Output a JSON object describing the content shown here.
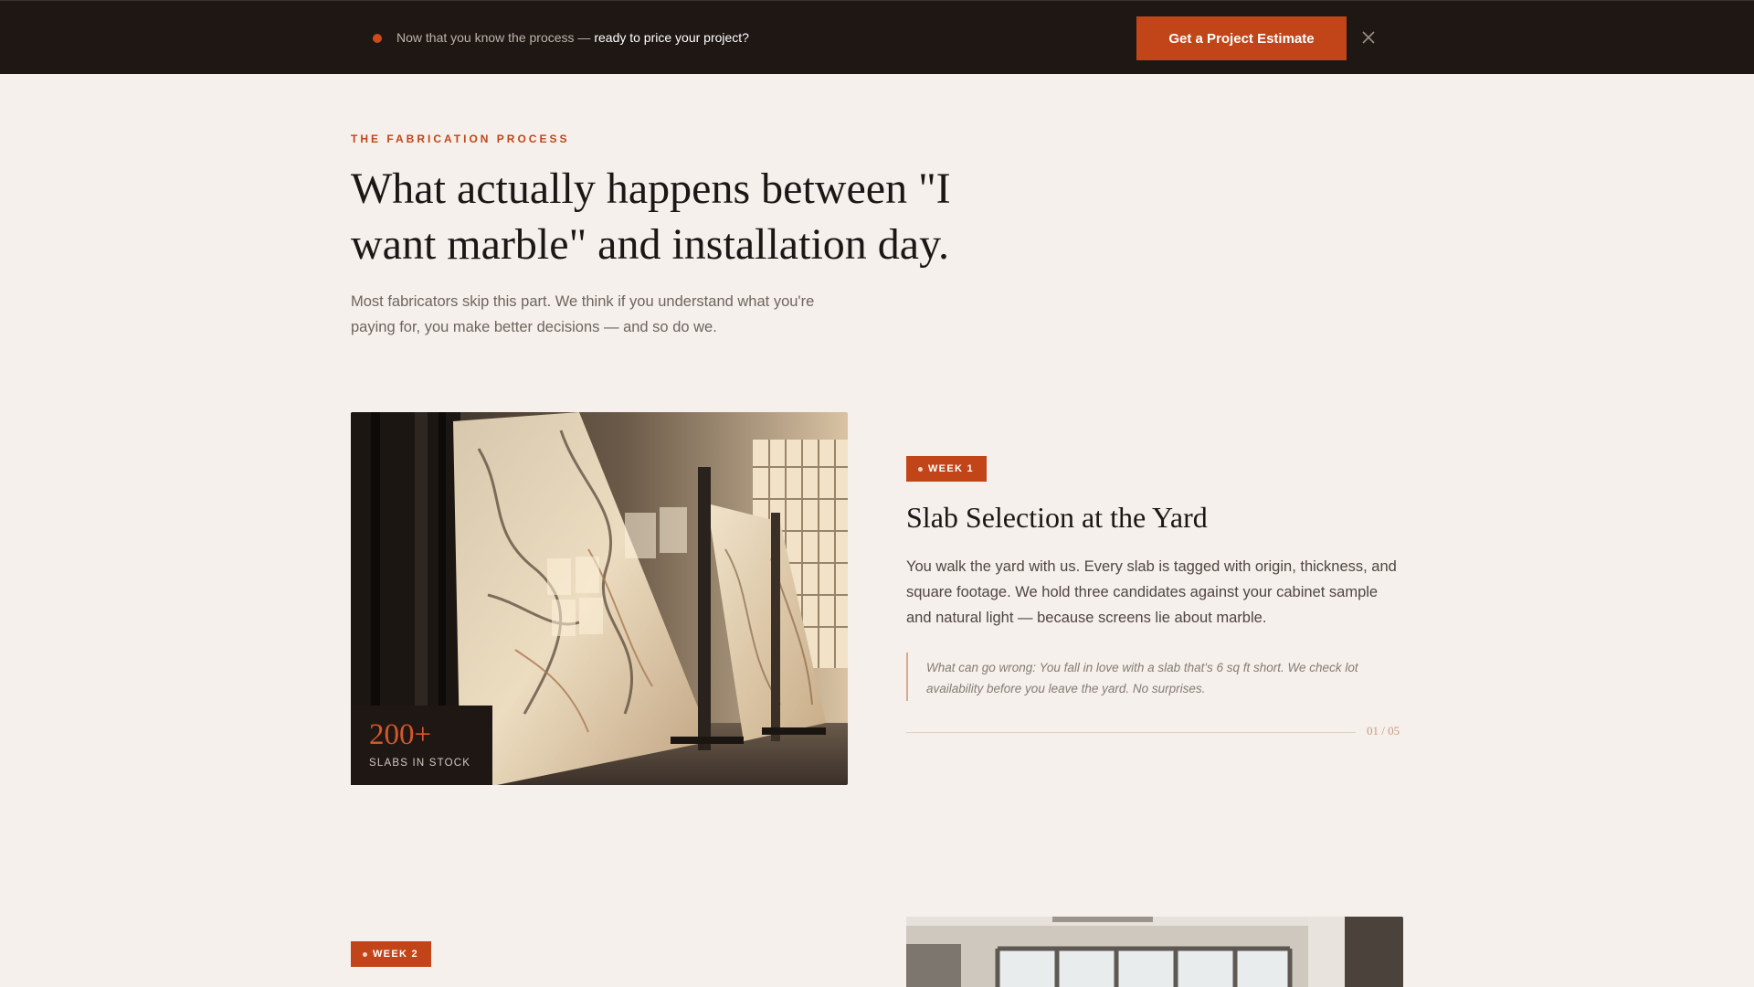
{
  "banner": {
    "text_lead": "Now that you know the process — ",
    "text_emphasis": "ready to price your project?",
    "cta_label": "Get a Project Estimate",
    "close_icon": "close-icon"
  },
  "intro": {
    "eyebrow": "THE FABRICATION PROCESS",
    "headline": "What actually happens between \"I want marble\" and installation day.",
    "description": "Most fabricators skip this part. We think if you understand what you're paying for, you make better decisions — and so do we."
  },
  "steps": [
    {
      "badge": "WEEK 1",
      "title": "Slab Selection at the Yard",
      "description": "You walk the yard with us. Every slab is tagged with origin, thickness, and square footage. We hold three candidates against your cabinet sample and natural light — because screens lie about marble.",
      "note": "What can go wrong: You fall in love with a slab that's 6 sq ft short. We check lot availability before you leave the yard. No surprises.",
      "counter": "01 / 05",
      "stat_value": "200+",
      "stat_label": "SLABS IN STOCK"
    },
    {
      "badge": "WEEK 2"
    }
  ],
  "colors": {
    "accent": "#c2451a",
    "banner_bg": "#1e1714",
    "page_bg": "#f5f0eb",
    "text_dark": "#1c1714"
  }
}
